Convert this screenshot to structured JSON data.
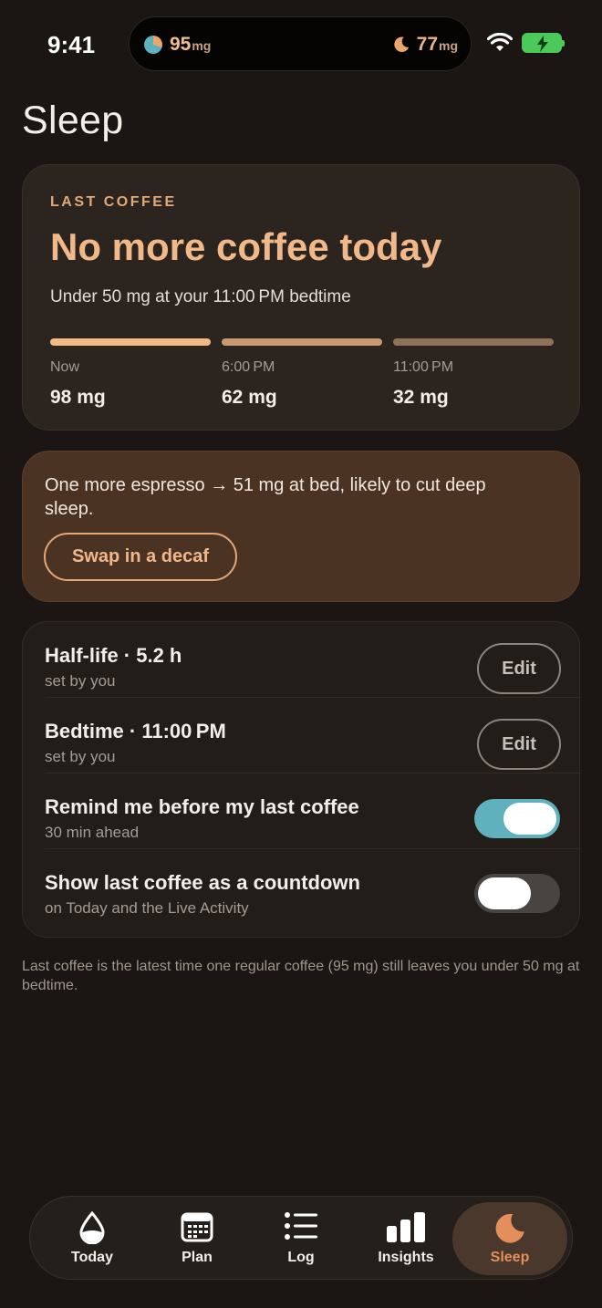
{
  "status_bar": {
    "time": "9:41",
    "island_level_value": "95",
    "island_level_unit": "mg",
    "island_bedtime_value": "77",
    "island_bedtime_unit": "mg",
    "battery_charging": true,
    "icons": [
      "caffeine-level-icon",
      "moon-icon",
      "wifi-icon",
      "battery-charging-icon"
    ]
  },
  "page_title": "Sleep",
  "last_coffee_card": {
    "eyebrow": "LAST COFFEE",
    "headline": "No more coffee today",
    "subline": "Under 50 mg at your 11:00 PM bedtime",
    "timeline": [
      {
        "time": "Now",
        "value": "98 mg",
        "color": "#f2bb85"
      },
      {
        "time": "6:00 PM",
        "value": "62 mg",
        "color": "#c79a72"
      },
      {
        "time": "11:00 PM",
        "value": "32 mg",
        "color": "#8f7258"
      }
    ]
  },
  "warning_card": {
    "text": "One more espresso → 51 mg at bed, likely to cut deep sleep.",
    "button_label": "Swap in a decaf"
  },
  "settings": {
    "half_life": {
      "title": "Half-life · 5.2 h",
      "subtitle": "set by you",
      "button": "Edit"
    },
    "bedtime": {
      "title": "Bedtime · 11:00 PM",
      "subtitle": "set by you",
      "button": "Edit"
    },
    "remind": {
      "title": "Remind me before my last coffee",
      "subtitle": "30 min ahead",
      "on": true
    },
    "countdown": {
      "title": "Show last coffee as a countdown",
      "subtitle": "on Today and the Live Activity",
      "on": false
    }
  },
  "footnote": "Last coffee is the latest time one regular coffee (95 mg) still leaves you under 50 mg at bedtime.",
  "tabs": [
    {
      "label": "Today",
      "icon": "drop-icon",
      "active": false
    },
    {
      "label": "Plan",
      "icon": "calendar-icon",
      "active": false
    },
    {
      "label": "Log",
      "icon": "list-icon",
      "active": false
    },
    {
      "label": "Insights",
      "icon": "bar-chart-icon",
      "active": false
    },
    {
      "label": "Sleep",
      "icon": "moon-icon",
      "active": true
    }
  ],
  "colors": {
    "background": "#1b1613",
    "accent": "#e9a76b",
    "toggle_on": "#5fb2bd",
    "toggle_off": "#4a4441",
    "active_tab": "#e38f5c"
  }
}
